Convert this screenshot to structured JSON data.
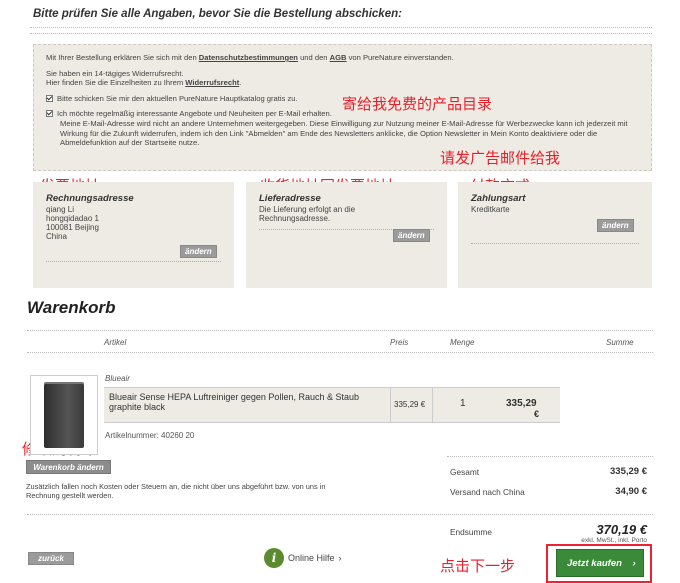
{
  "header": {
    "title": "Bitte prüfen Sie alle Angaben, bevor Sie die Bestellung abschicken:"
  },
  "terms": {
    "line1_pre": "Mit Ihrer Bestellung erklären Sie sich mit den ",
    "link_datenschutz": "Datenschutzbestimmungen",
    "line1_mid": " und den ",
    "link_agb": "AGB",
    "line1_post": " von PureNature einverstanden.",
    "line2": "Sie haben ein 14-tägiges Widerrufsrecht.",
    "line3_pre": "Hier finden Sie die Einzelheiten zu Ihrem ",
    "link_widerruf": "Widerrufsrecht",
    "line3_post": ".",
    "check1": "Bitte schicken Sie mir den aktuellen PureNature Hauptkatalog gratis zu.",
    "check2": "Ich möchte regelmäßig interessante Angebote und Neuheiten per E-Mail erhalten.",
    "check2_detail": "Meine E-Mail-Adresse wird nicht an andere Unternehmen weitergegeben. Diese Einwilligung zur Nutzung meiner E-Mail-Adresse für Werbezwecke kann ich jederzeit mit Wirkung für die Zukunft widerrufen, indem ich den Link \"Abmelden\" am Ende des Newsletters anklicke, die Option Newsletter in Mein Konto deaktiviere oder die Abmeldefunktion auf der Startseite nutze."
  },
  "annotations": {
    "catalog": "寄给我免费的产品目录",
    "newsletter": "请发广告邮件给我",
    "billing": "发票地址",
    "shipping": "收货地址同发票地址",
    "payment": "付款方式",
    "modify": "修改",
    "edit_cart": "修改购物车",
    "next_step": "点击下一步"
  },
  "billing": {
    "title": "Rechnungsadresse",
    "name": "qiang Li",
    "street": "hongqidadao 1",
    "city": "100081 Beijing",
    "country": "China",
    "edit": "ändern"
  },
  "shipping": {
    "title": "Lieferadresse",
    "text": "Die Lieferung erfolgt an die Rechnungsadresse.",
    "edit": "ändern"
  },
  "payment": {
    "title": "Zahlungsart",
    "method": "Kreditkarte",
    "edit": "ändern"
  },
  "cart": {
    "title": "Warenkorb",
    "columns": {
      "article": "Artikel",
      "price": "Preis",
      "qty": "Menge",
      "sum": "Summe"
    },
    "item": {
      "brand": "Blueair",
      "name": "Blueair Sense HEPA Luftreiniger gegen Pollen, Rauch & Staub graphite black",
      "price": "335,29 €",
      "qty": "1",
      "sum": "335,29",
      "sum_currency": "€",
      "article_no": "Artikelnummer: 40260 20"
    },
    "edit_button": "Warenkorb ändern",
    "note": "Zusätzlich fallen noch Kosten oder Steuern an, die nicht über uns abgeführt bzw. von uns in Rechnung gestellt werden."
  },
  "summary": {
    "total_label": "Gesamt",
    "total_value": "335,29 €",
    "shipping_label": "Versand nach China",
    "shipping_value": "34,90 €",
    "grand_label": "Endsumme",
    "grand_value": "370,19 €",
    "grand_sub1": "exkl. MwSt., inkl. Porto"
  },
  "footer": {
    "back": "zurück",
    "help_icon": "i",
    "help": "Online Hilfe",
    "help_arrow": "›",
    "buy": "Jetzt kaufen",
    "buy_arrow": "›"
  }
}
